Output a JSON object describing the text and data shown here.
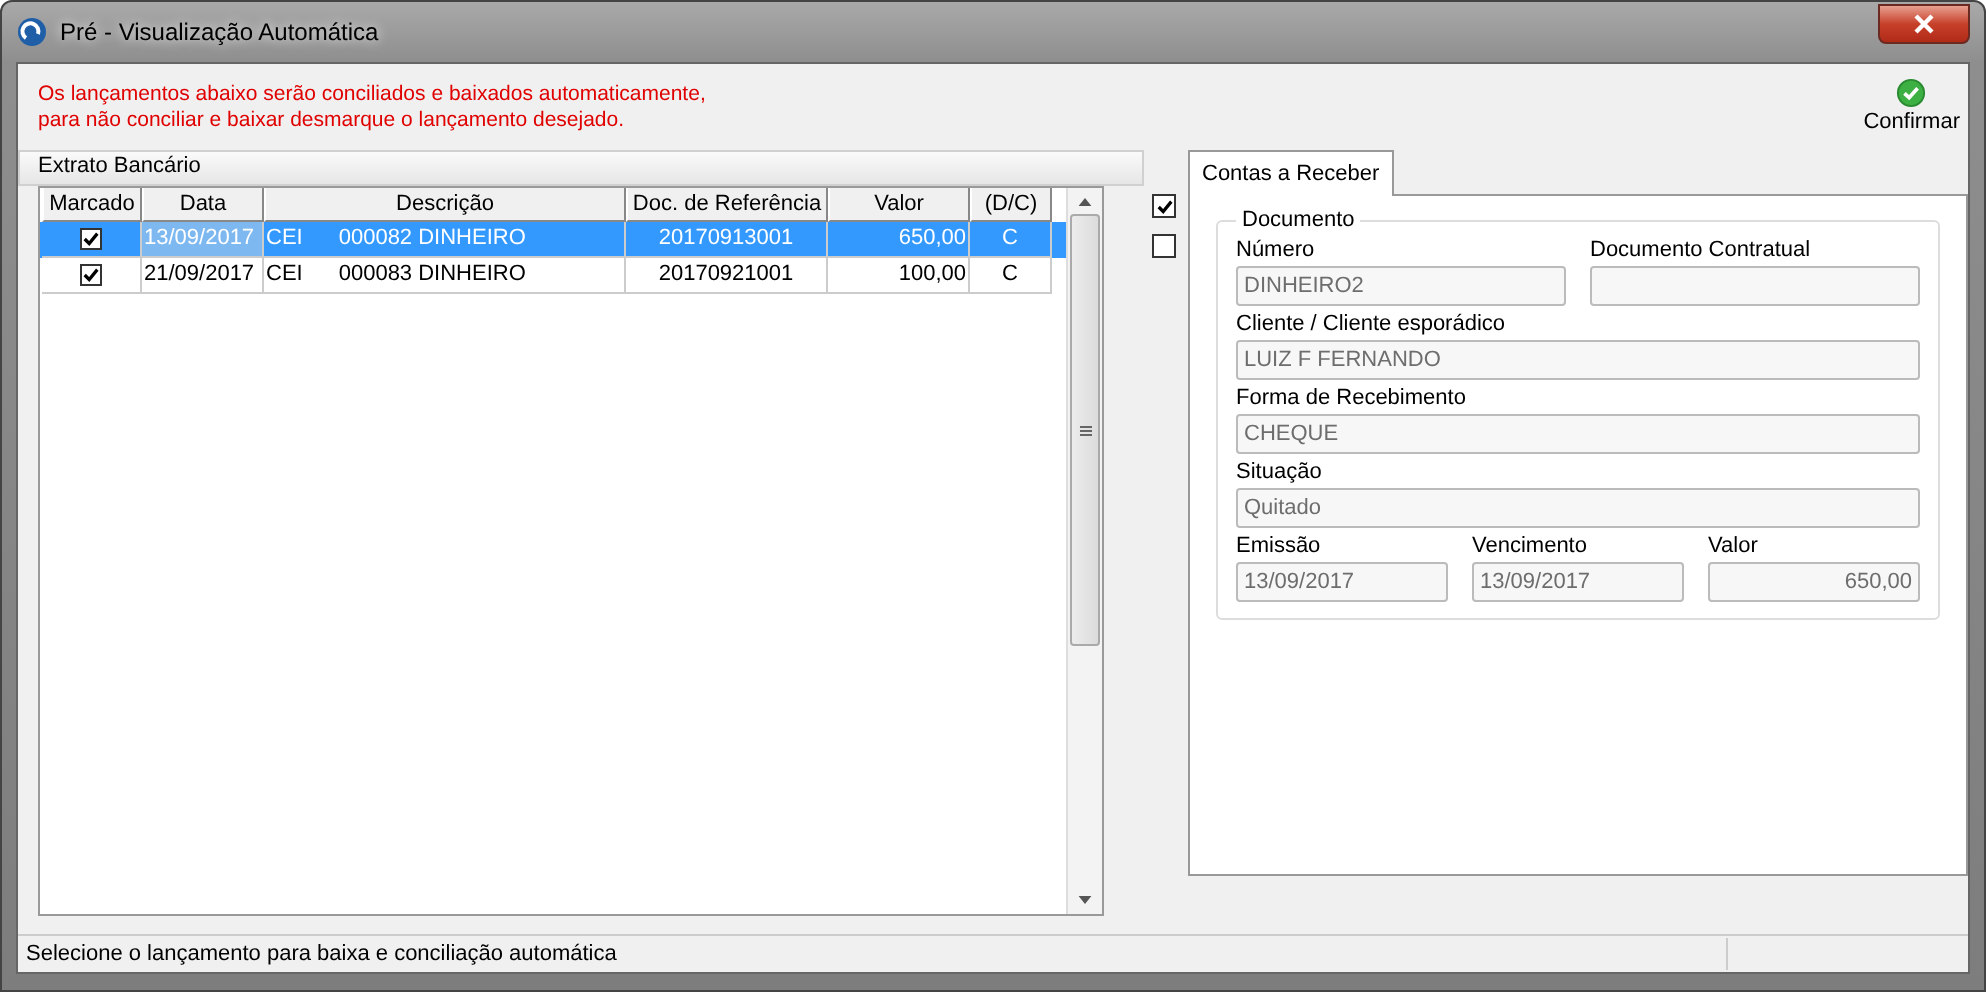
{
  "window": {
    "title": "Pré - Visualização Automática"
  },
  "notice": [
    "Os lançamentos abaixo serão conciliados e baixados automaticamente,",
    "para não conciliar e baixar desmarque o lançamento desejado."
  ],
  "confirm_button": {
    "label": "Confirmar"
  },
  "statement": {
    "title": "Extrato Bancário",
    "columns": [
      "Marcado",
      "Data",
      "Descrição",
      "Doc. de Referência",
      "Valor",
      "(D/C)"
    ],
    "rows": [
      {
        "marked": true,
        "selected": true,
        "date": "13/09/2017",
        "code": "CEI",
        "description": "000082 DINHEIRO",
        "reference": "20170913001",
        "amount": "650,00",
        "dc": "C"
      },
      {
        "marked": true,
        "selected": false,
        "date": "21/09/2017",
        "code": "CEI",
        "description": "000083 DINHEIRO",
        "reference": "20170921001",
        "amount": "100,00",
        "dc": "C"
      }
    ]
  },
  "side_toggles": [
    {
      "checked": true
    },
    {
      "checked": false
    }
  ],
  "tabs": [
    {
      "label": "Contas a Receber",
      "selected": true
    }
  ],
  "document": {
    "title": "Documento",
    "rows": [
      {
        "fields": [
          {
            "label": "Número",
            "value": "DINHEIRO2",
            "kind": "text"
          },
          {
            "label": "Documento Contratual",
            "kind": "text"
          }
        ]
      },
      {
        "fields": [
          {
            "label": "Cliente / Cliente esporádico",
            "value": "LUIZ F FERNANDO",
            "kind": "text"
          }
        ]
      },
      {
        "fields": [
          {
            "label": "Forma de Recebimento",
            "value": "CHEQUE",
            "kind": "text"
          }
        ]
      },
      {
        "fields": [
          {
            "label": "Situação",
            "value": "Quitado",
            "kind": "text"
          }
        ]
      },
      {
        "fields": [
          {
            "label": "Emissão",
            "value": "13/09/2017",
            "kind": "text"
          },
          {
            "label": "Vencimento",
            "value": "13/09/2017",
            "kind": "text"
          },
          {
            "label": "Valor",
            "value": "650,00",
            "kind": "amount"
          }
        ]
      }
    ]
  },
  "status_bar": {
    "text": "Selecione o lançamento para baixa e conciliação automática"
  }
}
